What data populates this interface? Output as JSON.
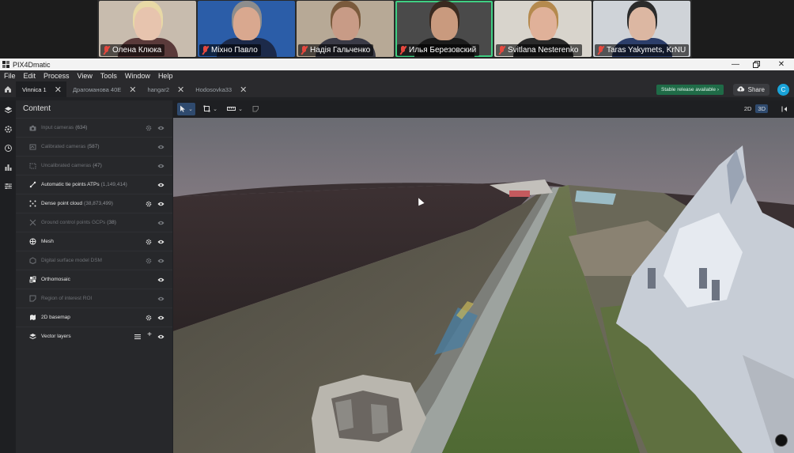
{
  "participants": [
    {
      "name": "Олена Клюка",
      "skin": "#e7c4ae",
      "hair": "#e8d9a6",
      "bg": "#c8bcae",
      "shirt": "#5a3a3a"
    },
    {
      "name": "Міхно Павло",
      "skin": "#d9a88f",
      "hair": "#8d8d8d",
      "bg": "#2b5da8",
      "shirt": "#1c2a4a"
    },
    {
      "name": "Надія Гальченко",
      "skin": "#c89b86",
      "hair": "#7a5a3c",
      "bg": "#b7a996",
      "shirt": "#3a3a46"
    },
    {
      "name": "Илья Березовский",
      "skin": "#c99a7e",
      "hair": "#3a2a20",
      "bg": "#4a4a4a",
      "shirt": "#1b1b1b"
    },
    {
      "name": "Svitlana Nesterenko",
      "skin": "#e0b199",
      "hair": "#b58a4e",
      "bg": "#d8d4cc",
      "shirt": "#2a2a2a"
    },
    {
      "name": "Taras Yakymets, KrNU",
      "skin": "#dcb7a2",
      "hair": "#2b2b2b",
      "bg": "#cfd3d8",
      "shirt": "#2c3e6a"
    }
  ],
  "app": {
    "title": "PIX4Dmatic",
    "menu": [
      "File",
      "Edit",
      "Process",
      "View",
      "Tools",
      "Window",
      "Help"
    ],
    "tabs": [
      {
        "label": "Vinnica 1",
        "active": true
      },
      {
        "label": "Драгоманова 40Е",
        "active": false
      },
      {
        "label": "hangar2",
        "active": false
      },
      {
        "label": "Hodosovka33",
        "active": false
      }
    ],
    "release_badge": "Stable release available",
    "share_label": "Share",
    "avatar_letter": "C",
    "view_2d": "2D",
    "view_3d": "3D"
  },
  "content": {
    "title": "Content",
    "layers": [
      {
        "label": "Input cameras",
        "count": "(634)",
        "on": false,
        "icon": "camera-icon",
        "gear": true,
        "eye": true
      },
      {
        "label": "Calibrated cameras",
        "count": "(587)",
        "on": false,
        "icon": "calibrated-camera-icon",
        "gear": false,
        "eye": true
      },
      {
        "label": "Uncalibrated cameras",
        "count": "(47)",
        "on": false,
        "icon": "uncalibrated-camera-icon",
        "gear": false,
        "eye": true
      },
      {
        "label": "Automatic tie points ATPs",
        "count": "(1,149,414)",
        "on": true,
        "icon": "tie-points-icon",
        "gear": false,
        "eye": true
      },
      {
        "label": "Dense point cloud",
        "count": "(38,873,499)",
        "on": true,
        "icon": "point-cloud-icon",
        "gear": true,
        "eye": true
      },
      {
        "label": "Ground control points GCPs",
        "count": "(38)",
        "on": false,
        "icon": "gcp-icon",
        "gear": false,
        "eye": true
      },
      {
        "label": "Mesh",
        "count": "",
        "on": true,
        "icon": "mesh-icon",
        "gear": true,
        "eye": true
      },
      {
        "label": "Digital surface model DSM",
        "count": "",
        "on": false,
        "icon": "dsm-icon",
        "gear": true,
        "eye": true
      },
      {
        "label": "Orthomosaic",
        "count": "",
        "on": true,
        "icon": "orthomosaic-icon",
        "gear": false,
        "eye": true
      },
      {
        "label": "Region of interest ROI",
        "count": "",
        "on": false,
        "icon": "roi-icon",
        "gear": false,
        "eye": true
      },
      {
        "label": "2D basemap",
        "count": "",
        "on": true,
        "icon": "basemap-icon",
        "gear": true,
        "eye": true
      },
      {
        "label": "Vector layers",
        "count": "",
        "on": true,
        "icon": "vector-layers-icon",
        "gear": false,
        "eye": true,
        "extras": true
      }
    ]
  }
}
